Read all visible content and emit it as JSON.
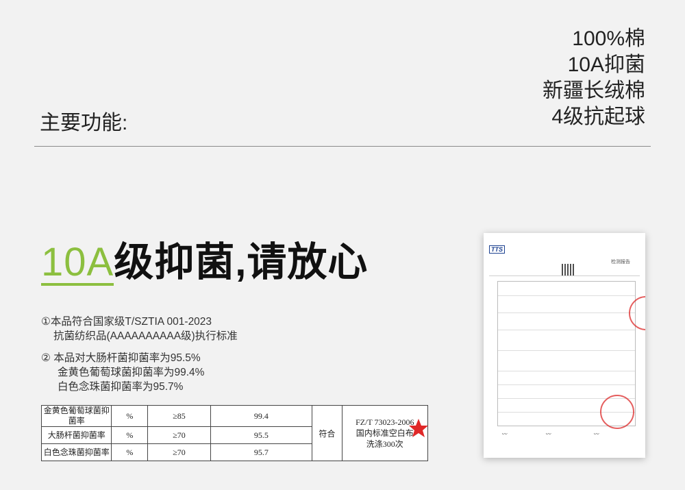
{
  "features": {
    "label": "主要功能:",
    "items": [
      "100%棉",
      "10A抑菌",
      "新疆长绒棉",
      "4级抗起球"
    ]
  },
  "headline": {
    "accent": "10A",
    "rest": "级抑菌,请放心"
  },
  "notes": {
    "note1_line1": "①本品符合国家级T/SZTIA 001-2023",
    "note1_line2": "抗菌纺织品(AAAAAAAAAA级)执行标准",
    "note2_line1": "② 本品对大肠杆菌抑菌率为95.5%",
    "note2_line2": "金黄色葡萄球菌抑菌率为99.4%",
    "note2_line3": "白色念珠菌抑菌率为95.7%"
  },
  "results_table": {
    "rows": [
      {
        "item": "金黄色葡萄球菌抑菌率",
        "unit": "%",
        "requirement": "≥85",
        "result": "99.4"
      },
      {
        "item": "大肠杆菌抑菌率",
        "unit": "%",
        "requirement": "≥70",
        "result": "95.5"
      },
      {
        "item": "白色念珠菌抑菌率",
        "unit": "%",
        "requirement": "≥70",
        "result": "95.7"
      }
    ],
    "verdict": "符合",
    "standard_line1": "FZ/T 73023-2006",
    "standard_line2": "国内标准空白布",
    "standard_line3": "洗涤300次"
  },
  "report": {
    "logo": "TTS",
    "title": "检测报告"
  },
  "colors": {
    "accent_green": "#8cbf3f",
    "stamp_red": "#e02828"
  }
}
